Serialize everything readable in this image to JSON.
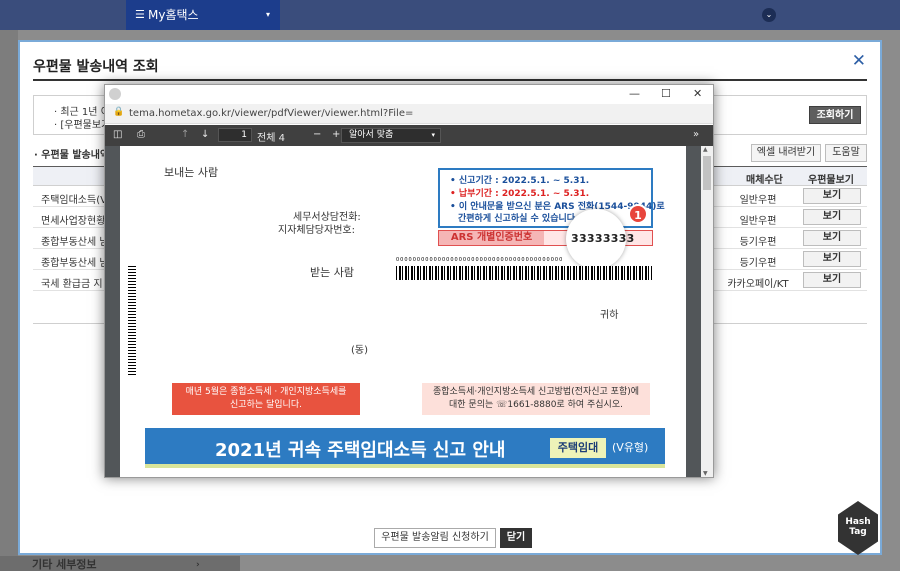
{
  "topbar": {
    "menu_label": "My홈택스",
    "menu_icon": "hamburger-icon",
    "caret": "▾",
    "circle_icon": "chevron-down-icon"
  },
  "background": {
    "footer_text": "기타 세부정보"
  },
  "modal": {
    "title": "우편물 발송내역 조회",
    "info_line1": "· 최근 1년 이",
    "info_line2": "· [우편물보기",
    "search_button": "조회하기",
    "section_title": "· 우편물 발송내역",
    "excel_button": "엑셀 내려받기",
    "help_button": "도움말",
    "columns": {
      "media": "매체수단",
      "view": "우편물보기"
    },
    "rows": [
      {
        "name": "주택임대소득(V",
        "media": "일반우편",
        "view": "보기"
      },
      {
        "name": "면세사업장현황",
        "media": "일반우편",
        "view": "보기"
      },
      {
        "name": "종합부동산세 닏",
        "media": "등기우편",
        "view": "보기"
      },
      {
        "name": "종합부동산세 닏",
        "media": "등기우편",
        "view": "보기"
      },
      {
        "name": "국세 환급금 지",
        "media": "카카오페이/KT",
        "view": "보기"
      }
    ],
    "apply_button": "우편물 발송알림 신청하기",
    "close_button": "닫기"
  },
  "pdf_window": {
    "url": "tema.hometax.go.kr/viewer/pdfViewer/viewer.html?File=",
    "page_current": "1",
    "page_total": "전체 4",
    "zoom": "알아서 맞춤"
  },
  "pdf_page": {
    "sender_label": "보내는 사람",
    "tel_label1": "세무서상담전화:",
    "tel_label2": "지자체담당자번호:",
    "notice_line1": "• 신고기간 : 2022.5.1. ~ 5.31.",
    "notice_line2": "• 납부기간 : 2022.5.1. ~ 5.31.",
    "notice_line3a": "• 이 안내문을 받으신 분은 ARS 전화(1544-9944)로",
    "notice_line3b": "간편하게 신고하실 수 있습니다.",
    "ars_label": "ARS 개별인증번호",
    "ars_number": "33333333",
    "marker": "1",
    "receiver_label": "받는 사람",
    "barcode_digits": "0000000000000000000000000000000000000000",
    "gwiha": "귀하",
    "dong": "(동)",
    "red_notice": "매년 5월은 종합소득세 · 개인지방소득세를\n신고하는 달입니다.",
    "pink_notice": "종합소득세·개인지방소득세 신고방법(전자신고 포함)에\n대한 문의는 ☏1661-8880로 하여 주십시오.",
    "banner_title": "2021년 귀속 주택임대소득 신고 안내",
    "banner_tag": "주택임대",
    "banner_tag2": "(V유형)"
  },
  "watermark": {
    "text": "Hash\nTag"
  }
}
